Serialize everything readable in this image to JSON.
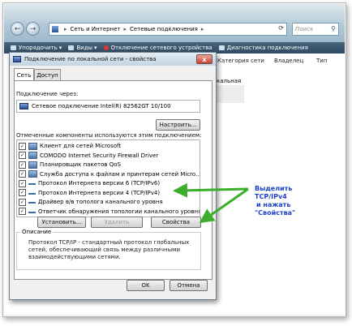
{
  "explorer": {
    "address": {
      "segments": [
        "Сеть и Интернет",
        "Сетевые подключения"
      ]
    },
    "search_placeholder": "Поиск",
    "toolbar": {
      "organize": "Упорядочить",
      "views": "Виды",
      "disconnect": "Отключение сетевого устройства",
      "diagnose": "Диагностика подключения"
    },
    "columns": {
      "category": "Категория сети",
      "owner": "Владелец",
      "type": "Тип"
    },
    "bg_fragment": "кальная"
  },
  "dialog": {
    "title": "Подключение по локальной сети - свойства",
    "close_glyph": "x",
    "tabs": [
      "Сеть",
      "Доступ"
    ],
    "connect_via_label": "Подключение через:",
    "adapter_name": "Сетевое подключение Intel(R) 82562GT 10/100",
    "configure_button": "Настроить...",
    "components_label": "Отмеченные компоненты используются этим подключением:",
    "components": [
      {
        "label": "Клиент для сетей Microsoft",
        "checked": true,
        "icon": "client-icon"
      },
      {
        "label": "COMODO Internet Security Firewall Driver",
        "checked": true,
        "icon": "driver-icon"
      },
      {
        "label": "Планировщик пакетов QoS",
        "checked": true,
        "icon": "scheduler-icon"
      },
      {
        "label": "Служба доступа к файлам и принтерам сетей Micro...",
        "checked": true,
        "icon": "service-icon"
      },
      {
        "label": "Протокол Интернета версии 6 (TCP/IPv6)",
        "checked": true,
        "icon": "protocol-icon"
      },
      {
        "label": "Протокол Интернета версии 4 (TCP/IPv4)",
        "checked": true,
        "icon": "protocol-icon"
      },
      {
        "label": "Драйвер в/в тополога канального уровня",
        "checked": true,
        "icon": "protocol-icon"
      },
      {
        "label": "Ответчик обнаружения топологии канального уровня",
        "checked": true,
        "icon": "protocol-icon"
      }
    ],
    "install_button": "Установить...",
    "remove_button": "Удалить",
    "properties_button": "Свойства",
    "description_title": "Описание",
    "description_text": "Протокол TCP/IP - стандартный протокол глобальных сетей, обеспечивающий связь между различными взаимодействующими сетями.",
    "ok_button": "OK",
    "cancel_button": "Отмена"
  },
  "annotation": {
    "line1": "Выделить TCP/IPv4",
    "line2": "и нажать",
    "line3": "\"Свойства\"",
    "color": "#1d40c9",
    "arrow_color": "#3dae2b"
  }
}
